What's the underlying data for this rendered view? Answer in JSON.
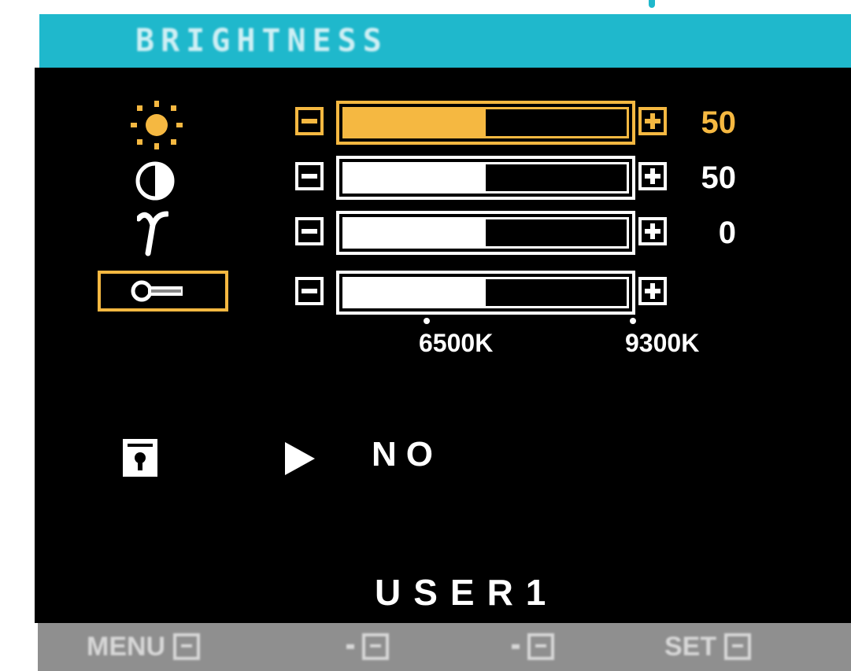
{
  "menu": {
    "title": "BRIGHTNESS"
  },
  "controls": [
    {
      "name": "brightness",
      "icon": "sun-icon",
      "level_percent": 50,
      "value_label": "50",
      "selected": true
    },
    {
      "name": "contrast",
      "icon": "contrast-icon",
      "level_percent": 50,
      "value_label": "50",
      "selected": false
    },
    {
      "name": "gamma",
      "icon": "gamma-icon",
      "level_percent": 50,
      "value_label": "0",
      "selected": false
    },
    {
      "name": "color-temperature",
      "icon": "color-temperature-icon",
      "level_percent": 50,
      "value_label": "",
      "selected": false
    }
  ],
  "color_temperature": {
    "markers": [
      "6500K",
      "9300K"
    ]
  },
  "reset": {
    "icon": "reset-icon",
    "value": "NO"
  },
  "mode": {
    "label": "USER1"
  },
  "bottom_bar": {
    "menu_label": "MENU",
    "set_label": "SET"
  },
  "colors": {
    "accent": "#f5b841",
    "title_bar": "#1fb8cc",
    "screen_bg": "#000000",
    "bottom_bar": "#8f8f8f"
  }
}
